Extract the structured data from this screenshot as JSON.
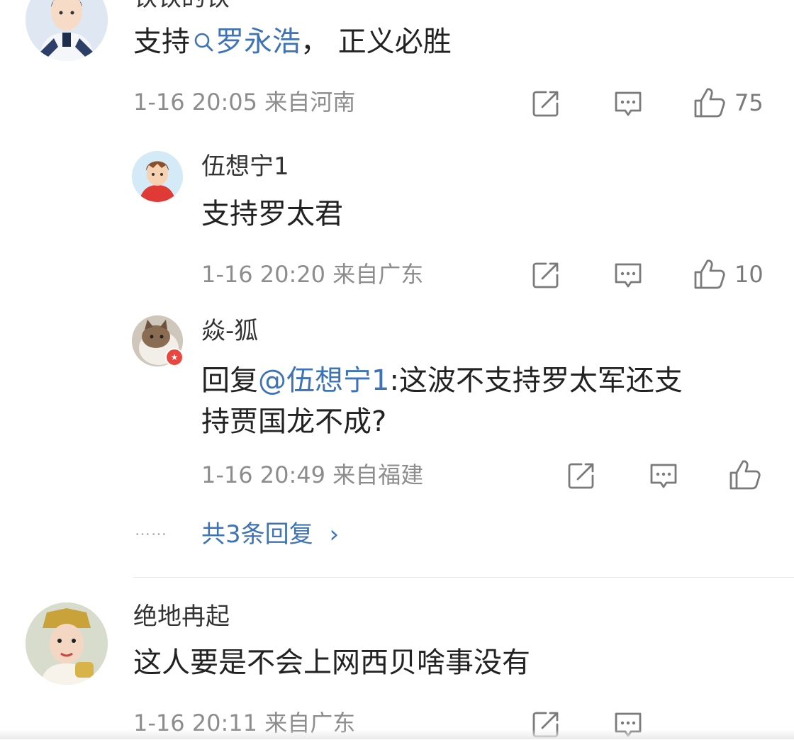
{
  "comments": [
    {
      "username": "铁铁的铁",
      "text_prefix": "支持",
      "topic_link": "罗永浩",
      "text_suffix": "， 正义必胜",
      "meta": "1-16 20:05 来自河南",
      "likes": "75"
    },
    {
      "username": "伍想宁1",
      "text": "支持罗太君",
      "meta": "1-16 20:20 来自广东",
      "likes": "10"
    },
    {
      "username": "焱-狐",
      "reply_prefix": "回复",
      "mention": "@伍想宁1",
      "text_line1_suffix": ":这波不支持罗太军还支",
      "text_line2": "持贾国龙不成?",
      "meta": "1-16 20:49 来自福建"
    },
    {
      "username": "绝地冉起",
      "text": "这人要是不会上网西贝啥事没有",
      "meta": "1-16 20:11 来自广东"
    }
  ],
  "more_replies": {
    "dots": "……",
    "label": "共3条回复",
    "chevron": "›"
  },
  "icons": [
    "repost-icon",
    "comment-icon",
    "like-icon",
    "search-icon",
    "chevron-right-icon"
  ],
  "colors": {
    "link": "#3e73b5",
    "meta": "#8d8d8d",
    "text": "#222222"
  }
}
